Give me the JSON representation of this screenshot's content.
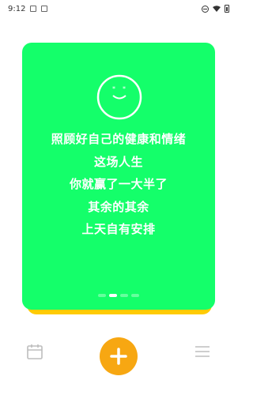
{
  "status_bar": {
    "time": "9:12"
  },
  "card": {
    "quote_lines": [
      "照顾好自己的健康和情绪",
      "这场人生",
      "你就赢了一大半了",
      "其余的其余",
      "上天自有安排"
    ],
    "page_count": 4,
    "active_page": 2,
    "colors": {
      "card": "#14ff6a",
      "card_shadow": "#ffcb05"
    }
  },
  "bottom_nav": {
    "icons": [
      "calendar-icon",
      "plus-icon",
      "menu-icon"
    ],
    "accent_color": "#f7a712"
  }
}
